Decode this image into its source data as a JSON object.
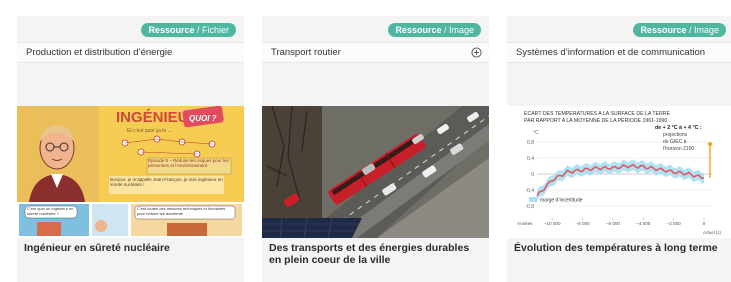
{
  "cards": [
    {
      "badge_type": "Ressource",
      "badge_sep": " / ",
      "badge_format": "Fichier",
      "category": "Production et distribution d’énergie",
      "title": "Ingénieur en sûreté nucléaire",
      "thumbnail": {
        "heading": "INGÉNIEUR",
        "bubble": "QUOI ?",
        "subtitle": "Et c’est quoi ça le ...",
        "episode": "Épisode 5 – Réduire les risques pour les personnes et l’environnement",
        "text1": "Bonjour, je m’appelle Jean-François, je suis ingénieur en sûreté nucléaire !",
        "text2": "C’est quoi un ingénieur en sûreté nucléaire ?",
        "text3": "C’est toutes ces mesures techniques et humaines pour réduire les accidents"
      }
    },
    {
      "badge_type": "Ressource",
      "badge_sep": " / ",
      "badge_format": "Image",
      "category": "Transport routier",
      "title": "Des transports et des énergies durables en plein coeur de la ville"
    },
    {
      "badge_type": "Ressource",
      "badge_sep": " / ",
      "badge_format": "Image",
      "category": "Systèmes d’information et de communication",
      "title": "Évolution des températures à long terme",
      "chart_data": {
        "type": "line",
        "title_line1": "ECART DES TEMPERATURES A LA SURFACE DE LA TERRE",
        "title_line2": "PAR RAPPORT A LA MOYENNE DE LA PÉRIODE 1961-1990",
        "ylabel": "°C",
        "yticks": [
          "0,8",
          "0,4",
          "0",
          "-0,4",
          "-0,8"
        ],
        "xlabel": "Années",
        "xticks": [
          "−10 000",
          "−8 000",
          "−6 000",
          "−4 000",
          "−2 000",
          "0"
        ],
        "xticks_after": "Actuel (1)",
        "x": [
          -11000,
          -10000,
          -9000,
          -8000,
          -7000,
          -6000,
          -5000,
          -4000,
          -3000,
          -2000,
          -1000,
          0,
          50,
          100,
          200
        ],
        "y": [
          -0.55,
          -0.15,
          0.05,
          0.1,
          0.15,
          0.15,
          0.2,
          0.18,
          0.12,
          0.05,
          0.0,
          -0.1,
          -0.05,
          0.7,
          0.75
        ],
        "band_label": "marge d’incertitude",
        "annotation_line1": "de + 2 °C à + 4 °C :",
        "annotation_line2": "projections",
        "annotation_line3": "du GIEC à",
        "annotation_line4": "l’horizon 2100",
        "colors": {
          "line": "#e05a60",
          "band": "#a8dff2",
          "projection": "#f2a21b"
        }
      }
    }
  ]
}
